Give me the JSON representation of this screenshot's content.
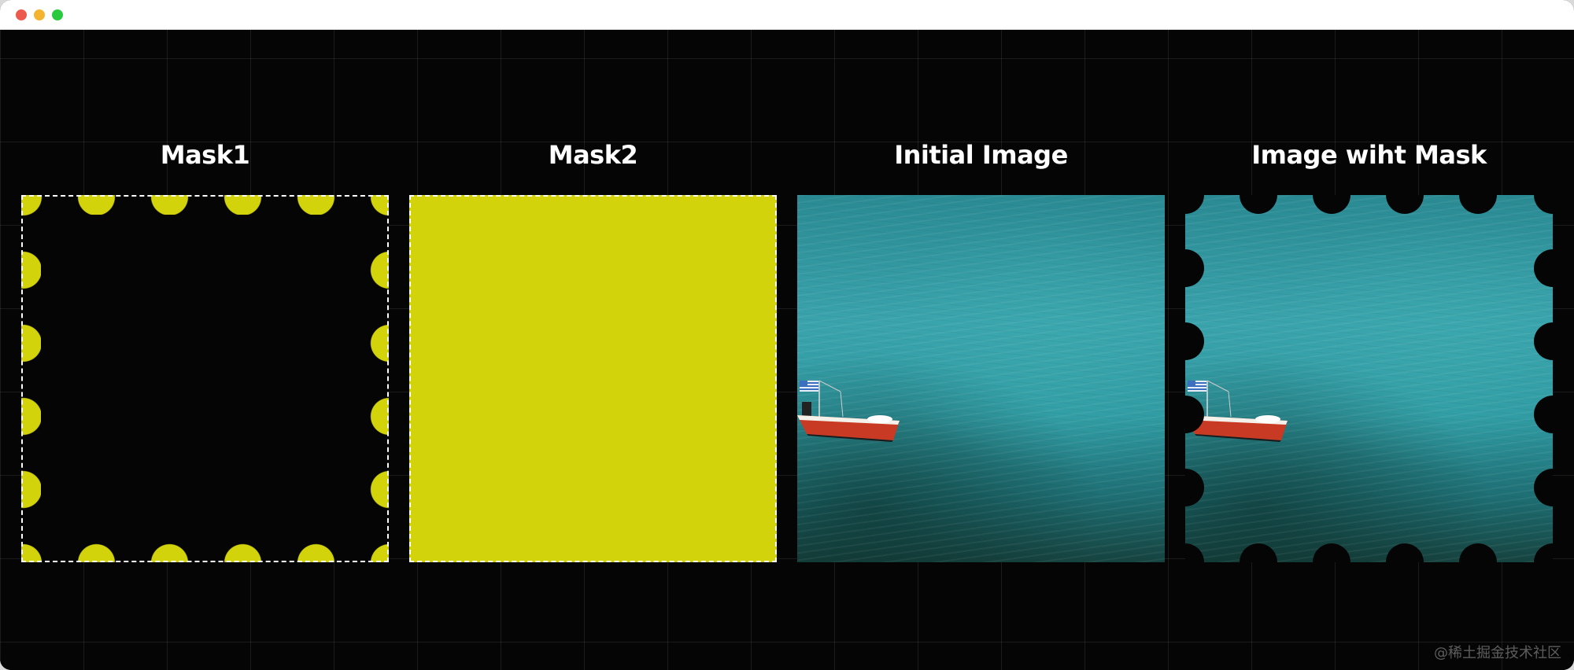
{
  "window": {
    "controls": [
      "close",
      "minimize",
      "zoom"
    ],
    "colors": {
      "close": "#ed5a4d",
      "minimize": "#f5b42f",
      "zoom": "#29c940"
    }
  },
  "panels": [
    {
      "title": "Mask1"
    },
    {
      "title": "Mask2"
    },
    {
      "title": "Initial Image"
    },
    {
      "title": "Image wiht Mask"
    }
  ],
  "colors": {
    "accent": "#d3d30c",
    "background": "#050505"
  },
  "watermark": "@稀土掘金技术社区"
}
